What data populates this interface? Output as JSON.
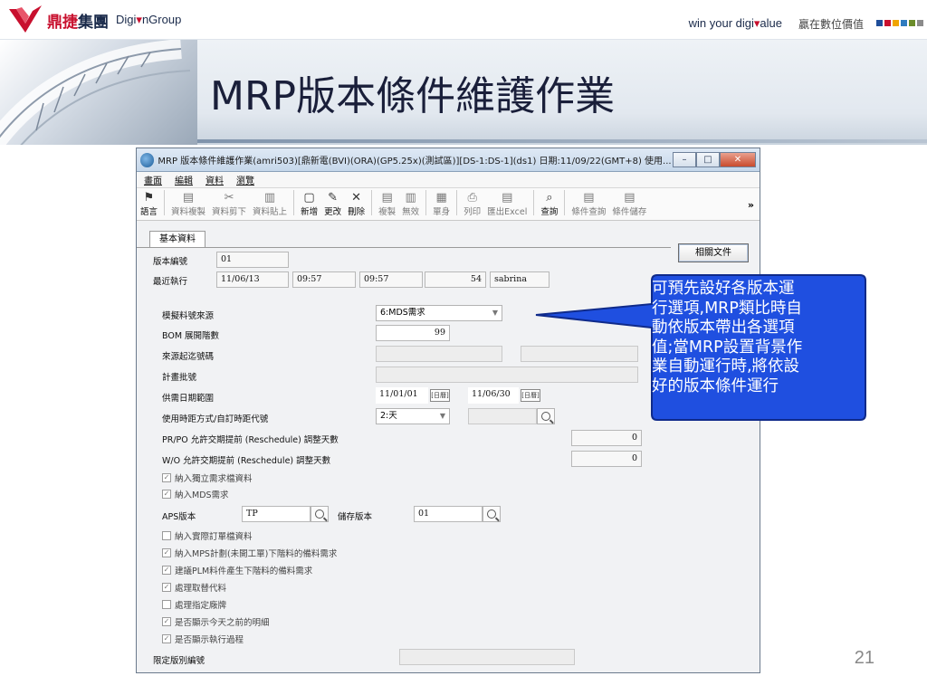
{
  "slide": {
    "brand_cn_red": "鼎捷",
    "brand_cn_rest": "集團",
    "brand_en_pre": "Digi",
    "brand_en_post": "nGroup",
    "slogan_pre": "win your digi",
    "slogan_post": "alue",
    "slogan_cn": "贏在數位價值",
    "title": "MRP版本條件維護作業",
    "page_number": "21",
    "accent_squares": [
      "#1f4e9a",
      "#c8102e",
      "#f0a400",
      "#2e7bbf",
      "#6b8c2a",
      "#8b8b8b"
    ]
  },
  "window": {
    "title": "MRP 版本條件維護作業(amri503)[鼎新電(BVI)(ORA)(GP5.25x)(測試區)][DS-1:DS-1](ds1) 日期:11/09/22(GMT+8) 使用...",
    "min_label": "–",
    "max_label": "□",
    "close_label": "✕"
  },
  "menu": [
    "畫面",
    "編輯",
    "資料",
    "瀏覽"
  ],
  "toolbar": {
    "items": [
      {
        "icon": "⚑",
        "label": "語言",
        "muted": false
      },
      {
        "icon": "▤",
        "label": "資料複製",
        "muted": true
      },
      {
        "icon": "✂",
        "label": "資料剪下",
        "muted": true
      },
      {
        "icon": "▥",
        "label": "資料貼上",
        "muted": true
      },
      {
        "icon": "▢",
        "label": "新增",
        "muted": false
      },
      {
        "icon": "✎",
        "label": "更改",
        "muted": false
      },
      {
        "icon": "✕",
        "label": "刪除",
        "muted": false
      },
      {
        "icon": "▤",
        "label": "複製",
        "muted": true
      },
      {
        "icon": "▥",
        "label": "無效",
        "muted": true
      },
      {
        "icon": "▦",
        "label": "單身",
        "muted": true
      },
      {
        "icon": "⎙",
        "label": "列印",
        "muted": true
      },
      {
        "icon": "▤",
        "label": "匯出Excel",
        "muted": true
      },
      {
        "icon": "⌕",
        "label": "查詢",
        "muted": false
      },
      {
        "icon": "▤",
        "label": "條件查詢",
        "muted": true
      },
      {
        "icon": "▤",
        "label": "條件儲存",
        "muted": true
      }
    ],
    "more": "»"
  },
  "form": {
    "tab": "基本資料",
    "related_button": "相關文件",
    "version_label": "版本編號",
    "version_value": "01",
    "last_run_label": "最近執行",
    "last_run_date": "11/06/13",
    "last_run_time1": "09:57",
    "last_run_time2": "09:57",
    "last_run_count": "54",
    "last_run_user": "sabrina",
    "source_label": "模擬料號來源",
    "source_value": "6:MDS需求",
    "bom_label": "BOM 展開階數",
    "bom_value": "99",
    "source_doc_label": "來源起迄號碼",
    "plan_batch_label": "計畫批號",
    "date_range_label": "供需日期範圍",
    "date_from": "11/01/01",
    "date_to": "11/06/30",
    "date_btn": "[日曆]",
    "time_method_label": "使用時距方式/自訂時距代號",
    "time_method_value": "2:天",
    "pr_po_label": "PR/PO 允許交期提前 (Reschedule) 調整天數",
    "pr_po_value": "0",
    "wo_label": "W/O 允許交期提前 (Reschedule) 調整天數",
    "wo_value": "0",
    "cb_independent": "納入獨立需求檔資料",
    "cb_mds": "納入MDS需求",
    "aps_label": "APS版本",
    "aps_value": "TP",
    "save_version_label": "儲存版本",
    "save_version_value": "01",
    "cb_actual_order": "納入實際訂單檔資料",
    "cb_mps": "納入MPS計劃(未開工單)下階料的備料需求",
    "cb_plm": "建議PLM料件產生下階料的備料需求",
    "cb_substitute": "處理取替代料",
    "cb_brand": "處理指定廠牌",
    "cb_show_before_today": "是否顯示今天之前的明細",
    "cb_show_process": "是否顯示執行過程",
    "limit_label": "限定版別編號"
  },
  "callout": {
    "lines": [
      "可預先設好各版本運",
      "行選項,MRP類比時自",
      "動依版本帶出各選項",
      "值;當MRP設置背景作",
      "業自動運行時,將依設",
      "好的版本條件運行"
    ],
    "fill": "#1f4fe0",
    "stroke": "#0f2a8a"
  }
}
